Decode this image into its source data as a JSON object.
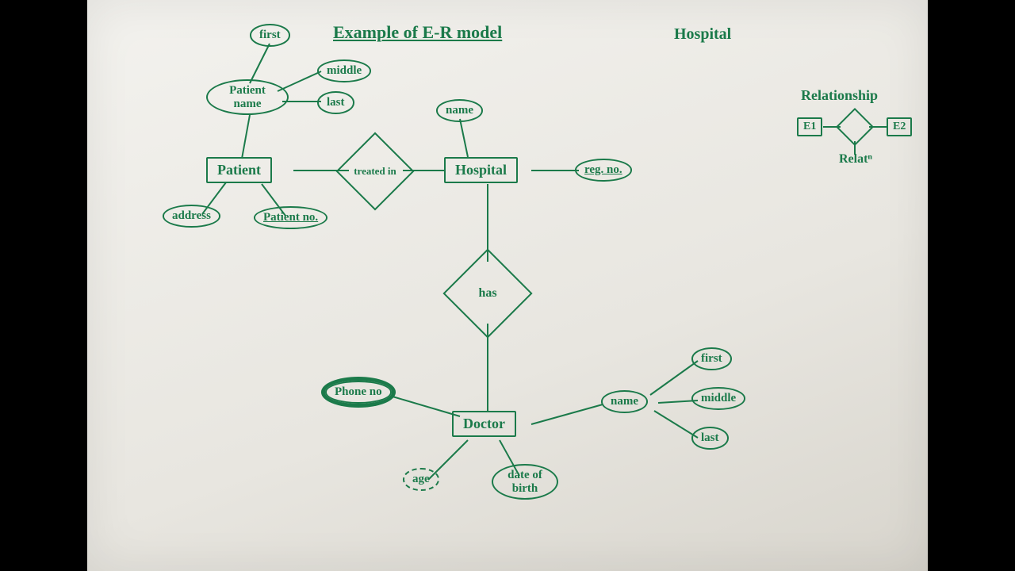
{
  "title": "Example of E-R model",
  "context_label": "Hospital",
  "entities": {
    "patient": "Patient",
    "hospital": "Hospital",
    "doctor": "Doctor"
  },
  "relationships": {
    "treated_in": "treated in",
    "has": "has"
  },
  "attributes": {
    "patient": {
      "name": "Patient name",
      "first": "first",
      "middle": "middle",
      "last": "last",
      "address": "address",
      "patient_no": "Patient no."
    },
    "hospital": {
      "name": "name",
      "reg_no": "reg. no."
    },
    "doctor": {
      "phone_no": "Phone no",
      "age": "age",
      "dob": "date of birth",
      "name": "name",
      "first": "first",
      "middle": "middle",
      "last": "last"
    }
  },
  "legend": {
    "title": "Relationship",
    "e1": "E1",
    "e2": "E2",
    "relat": "Relatⁿ"
  }
}
